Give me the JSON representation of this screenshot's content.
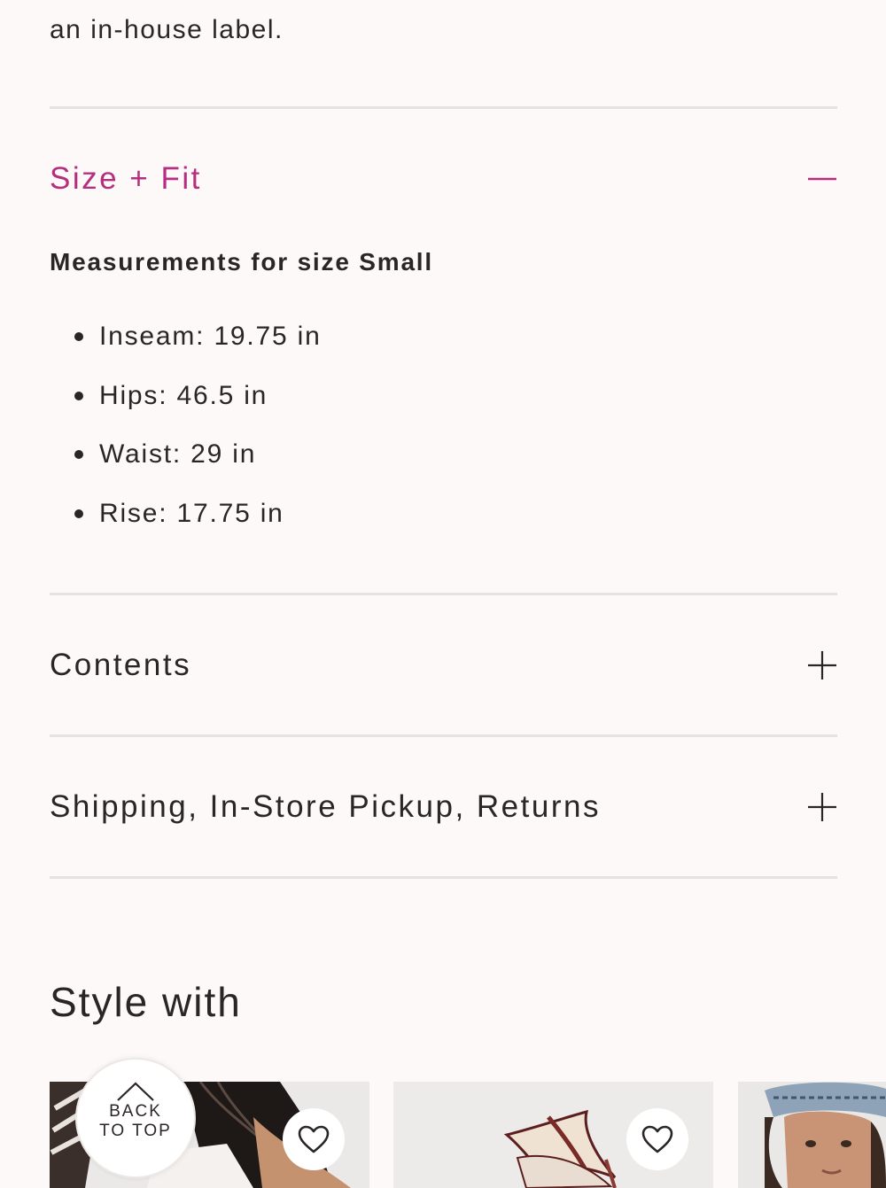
{
  "product_details": {
    "description_tail": "an in-house label."
  },
  "accordion": {
    "size_fit": {
      "title": "Size + Fit",
      "state": "expanded",
      "accent_color": "#b62e7f",
      "measurements_heading": "Measurements for size Small",
      "measurements": [
        {
          "label": "Inseam: 19.75 in"
        },
        {
          "label": "Hips: 46.5 in"
        },
        {
          "label": "Waist: 29 in"
        },
        {
          "label": "Rise: 17.75 in"
        }
      ]
    },
    "contents": {
      "title": "Contents",
      "state": "collapsed"
    },
    "shipping": {
      "title": "Shipping, In-Store Pickup, Returns",
      "state": "collapsed"
    }
  },
  "style_with": {
    "heading": "Style with",
    "cards": [
      {
        "name": "product-card-1",
        "favorite_icon": "heart-outline-icon"
      },
      {
        "name": "product-card-2",
        "favorite_icon": "heart-outline-icon"
      },
      {
        "name": "product-card-3"
      }
    ]
  },
  "back_to_top": {
    "line1": "BACK",
    "line2": "TO TOP",
    "icon": "chevron-up-icon"
  }
}
